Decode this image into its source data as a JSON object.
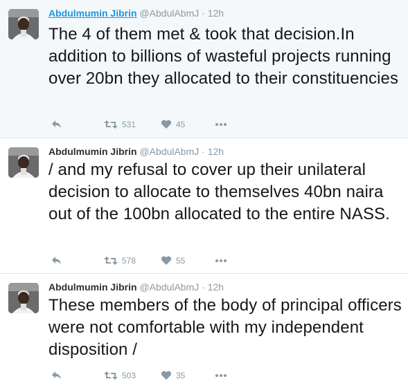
{
  "tweets": [
    {
      "name": "Abdulmumin Jibrin",
      "handle": "@AbdulAbmJ",
      "separator": "·",
      "time": "12h",
      "text": "The 4 of them met & took that decision.In addition to billions of wasteful projects running over 20bn they allocated to their constituencies",
      "retweets": "531",
      "likes": "45"
    },
    {
      "name": "Abdulmumin Jibrin",
      "handle": "@AbdulAbmJ",
      "separator": "·",
      "time": "12h",
      "text": "/ and my refusal to cover up their unilateral decision to allocate to themselves 40bn naira out of the 100bn allocated to the entire NASS.",
      "retweets": "578",
      "likes": "55"
    },
    {
      "name": "Abdulmumin Jibrin",
      "handle": "@AbdulAbmJ",
      "separator": "·",
      "time": "12h",
      "text": "These members of the body of principal officers were not comfortable with my independent disposition /",
      "retweets": "503",
      "likes": "35"
    }
  ],
  "icons": {
    "reply": "reply-icon",
    "retweet": "retweet-icon",
    "like": "heart-icon",
    "more": "more-icon"
  },
  "colors": {
    "name_link": "#1b95e0",
    "muted": "#8899a6",
    "text": "#14171a",
    "highlight_bg": "#f5f8fa"
  }
}
